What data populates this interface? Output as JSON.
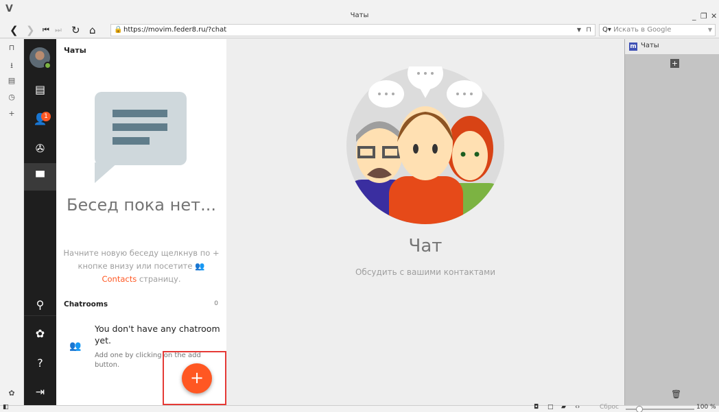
{
  "window": {
    "title": "Чаты"
  },
  "toolbar": {
    "url": "https://movim.feder8.ru/?chat",
    "search_placeholder": "Искать в Google",
    "search_prefix": "Q▾"
  },
  "nav": {
    "badge_count": "1"
  },
  "list": {
    "heading": "Чаты",
    "empty_title": "Бесед пока нет...",
    "empty_text_before": "Начните новую беседу щелкнув по + кнопке внизу или посетите ",
    "contacts_link": "Contacts",
    "empty_text_after": " страницу.",
    "chatrooms_label": "Chatrooms",
    "chatrooms_count": "0",
    "no_room_title": "You don't have any chatroom yet.",
    "no_room_sub": "Add one by clicking on the add button.",
    "fab_label": "+"
  },
  "main": {
    "title": "Чат",
    "subtitle": "Обсудить с вашими контактами"
  },
  "webpanel": {
    "tab_label": "Чаты",
    "icon_letter": "m"
  },
  "statusbar": {
    "reset_label": "Сброс",
    "zoom": "100 %"
  },
  "colors": {
    "accent": "#ff5722",
    "nav_bg": "#1e1e1e",
    "online": "#7cb342"
  }
}
